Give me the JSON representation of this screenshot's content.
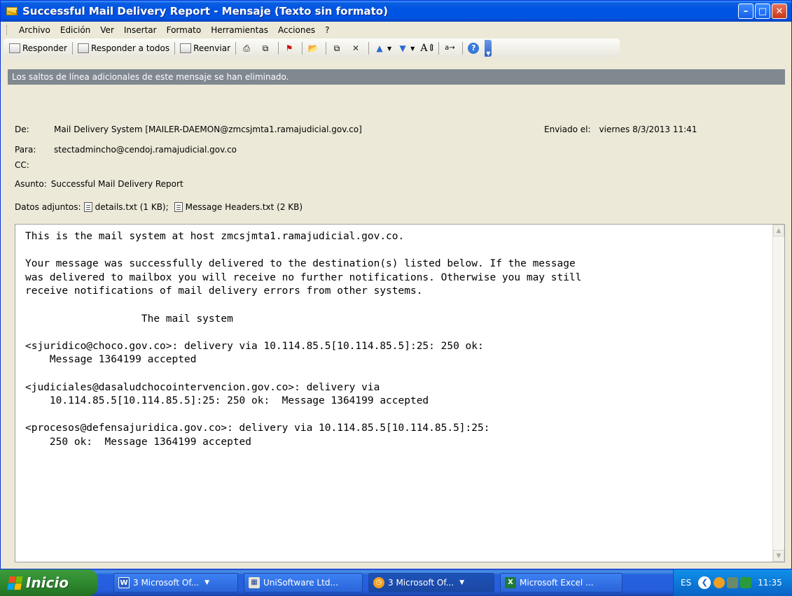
{
  "window": {
    "title": "Successful Mail Delivery Report - Mensaje (Texto sin formato)"
  },
  "menu": {
    "items": [
      "Archivo",
      "Edición",
      "Ver",
      "Insertar",
      "Formato",
      "Herramientas",
      "Acciones",
      "?"
    ]
  },
  "toolbar": {
    "reply": "Responder",
    "reply_all": "Responder a todos",
    "forward": "Reenviar"
  },
  "infobar": {
    "text": "Los saltos de línea adicionales de este mensaje se han eliminado."
  },
  "header": {
    "from_label": "De:",
    "from_value": "Mail Delivery System [MAILER-DAEMON@zmcsjmta1.ramajudicial.gov.co]",
    "sent_label": "Enviado el:",
    "sent_value": "viernes 8/3/2013 11:41",
    "to_label": "Para:",
    "to_value": "stectadmincho@cendoj.ramajudicial.gov.co",
    "cc_label": "CC:",
    "subject_label": "Asunto:",
    "subject_value": "Successful Mail Delivery Report",
    "attachments_label": "Datos adjuntos:",
    "attachment_1": "details.txt (1 KB);",
    "attachment_2": "Message Headers.txt (2 KB)"
  },
  "body": {
    "text": "This is the mail system at host zmcsjmta1.ramajudicial.gov.co.\n\nYour message was successfully delivered to the destination(s) listed below. If the message\nwas delivered to mailbox you will receive no further notifications. Otherwise you may still\nreceive notifications of mail delivery errors from other systems.\n\n                   The mail system\n\n<sjuridico@choco.gov.co>: delivery via 10.114.85.5[10.114.85.5]:25: 250 ok:\n    Message 1364199 accepted\n\n<judiciales@dasaludchocointervencion.gov.co>: delivery via\n    10.114.85.5[10.114.85.5]:25: 250 ok:  Message 1364199 accepted\n\n<procesos@defensajuridica.gov.co>: delivery via 10.114.85.5[10.114.85.5]:25:\n    250 ok:  Message 1364199 accepted"
  },
  "taskbar": {
    "start": "Inicio",
    "tasks": [
      {
        "label": "3 Microsoft Of...",
        "icon": "word-icon"
      },
      {
        "label": "UniSoftware Ltd...",
        "icon": "app-icon"
      },
      {
        "label": "3 Microsoft Of...",
        "icon": "outlook-icon"
      },
      {
        "label": "Microsoft Excel ...",
        "icon": "excel-icon"
      }
    ],
    "lang": "ES",
    "clock": "11:35"
  },
  "colors": {
    "titlebar": "#0054e3",
    "window_bg": "#ece9d8",
    "infobar_bg": "#808890",
    "taskbar": "#245ddb",
    "start": "#2f8a2f"
  }
}
